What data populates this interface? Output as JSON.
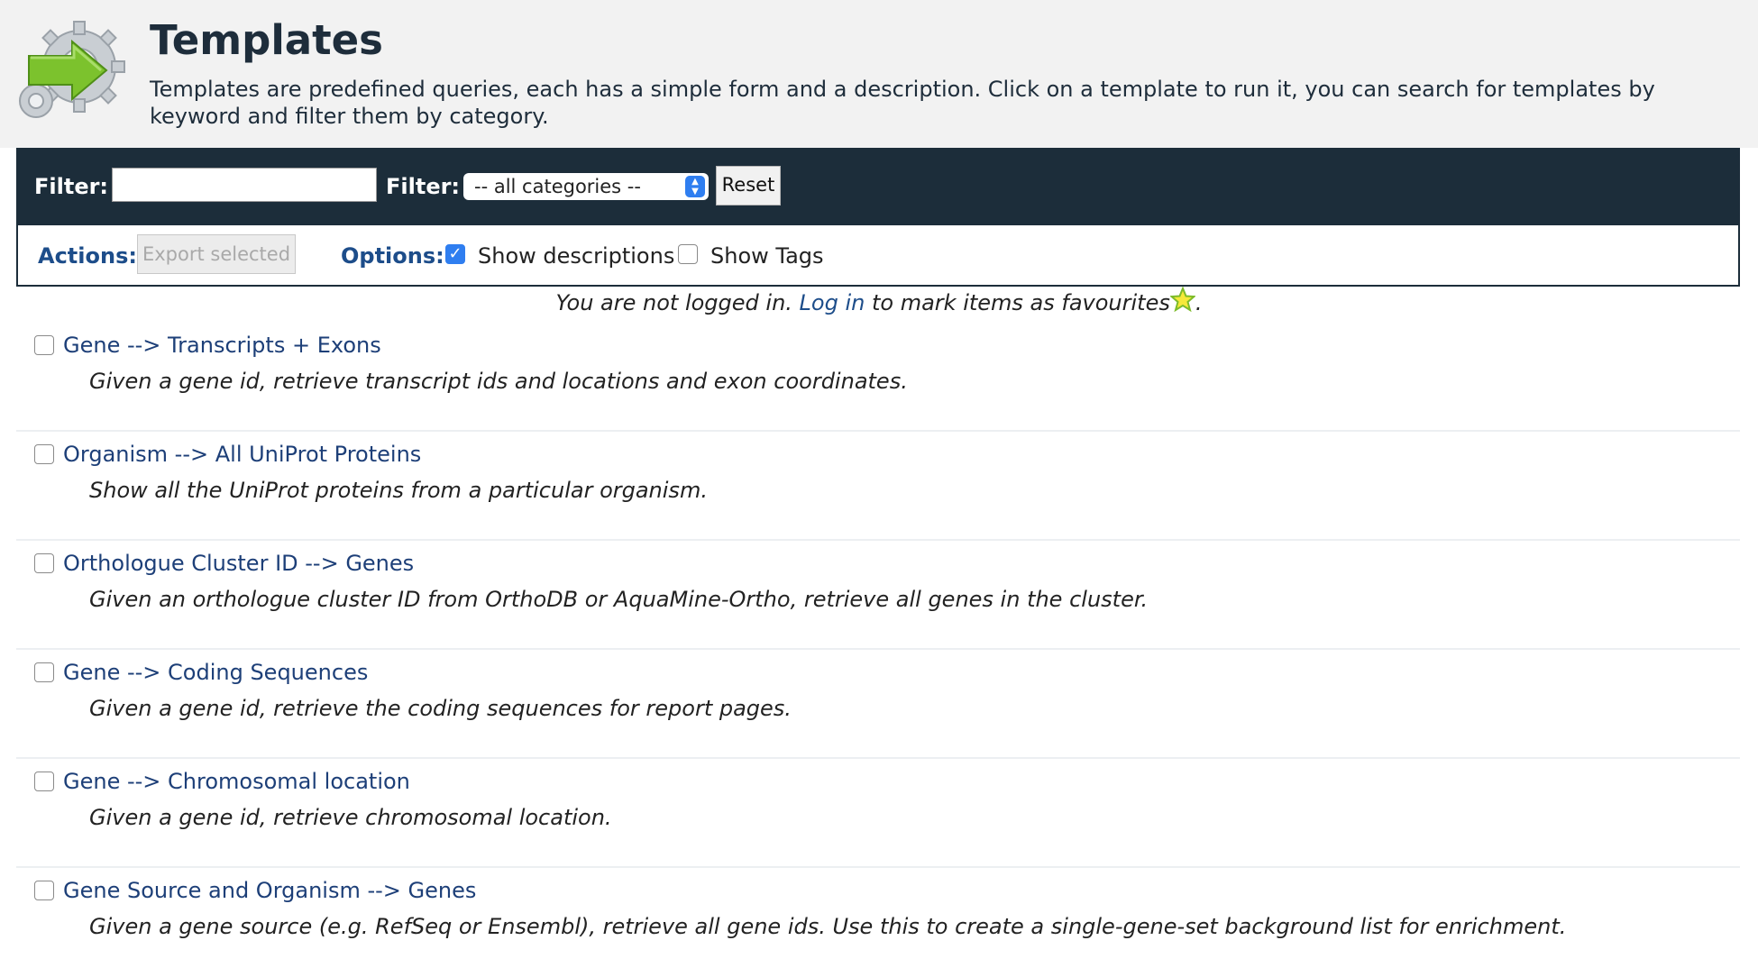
{
  "header": {
    "title": "Templates",
    "description": "Templates are predefined queries, each has a simple form and a description. Click on a template to run it, you can search for templates by keyword and filter them by category.",
    "icon": "gear-arrow-icon"
  },
  "filter_bar": {
    "keyword_label": "Filter:",
    "keyword_value": "",
    "category_label": "Filter:",
    "category_selected": "-- all categories --",
    "reset_label": "Reset"
  },
  "actions_bar": {
    "actions_label": "Actions:",
    "export_label": "Export selected",
    "options_label": "Options:",
    "show_descriptions_label": "Show descriptions",
    "show_descriptions_checked": true,
    "show_tags_label": "Show Tags",
    "show_tags_checked": false
  },
  "login_notice": {
    "prefix": "You are not logged in.",
    "link": "Log in",
    "suffix": "to mark items as favourites",
    "end": "."
  },
  "templates": [
    {
      "name": "Gene --> Transcripts + Exons",
      "description": "Given a gene id, retrieve transcript ids and locations and exon coordinates."
    },
    {
      "name": "Organism --> All UniProt Proteins",
      "description": "Show all the UniProt proteins from a particular organism."
    },
    {
      "name": "Orthologue Cluster ID --> Genes",
      "description": "Given an orthologue cluster ID from OrthoDB or AquaMine-Ortho, retrieve all genes in the cluster."
    },
    {
      "name": "Gene --> Coding Sequences",
      "description": "Given a gene id, retrieve the coding sequences for report pages."
    },
    {
      "name": "Gene --> Chromosomal location",
      "description": "Given a gene id, retrieve chromosomal location."
    },
    {
      "name": "Gene Source and Organism --> Genes",
      "description": "Given a gene source (e.g. RefSeq or Ensembl), retrieve all gene ids. Use this to create a single-gene-set background list for enrichment."
    }
  ]
}
